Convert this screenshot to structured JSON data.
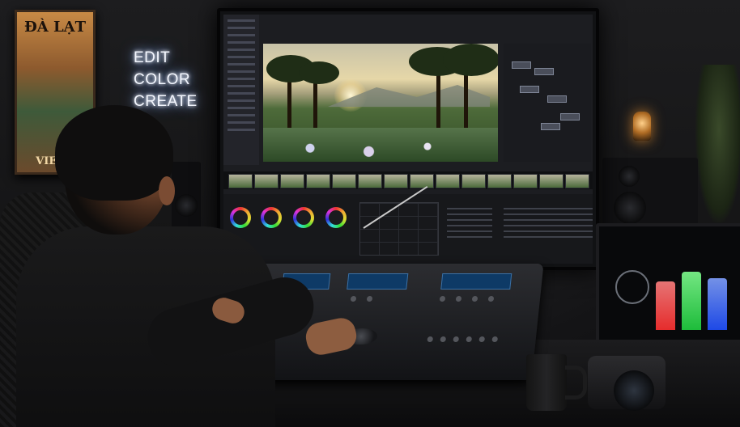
{
  "scene": {
    "description_kind": "photo",
    "neon_sign": {
      "lines": [
        "EDIT",
        "COLOR",
        "CREATE"
      ]
    },
    "poster": {
      "title": "ĐÀ LẠT",
      "footer": "VIETN"
    }
  },
  "icons": [
    "neon-sign",
    "poster",
    "monitor",
    "color-wheels",
    "console",
    "scope-monitor",
    "mug",
    "camera",
    "lamp",
    "speakers"
  ],
  "colors": {
    "neon_glow": "#9fc2ff",
    "wall": "#1d1d1f",
    "ui_dark": "#1c1d21"
  }
}
